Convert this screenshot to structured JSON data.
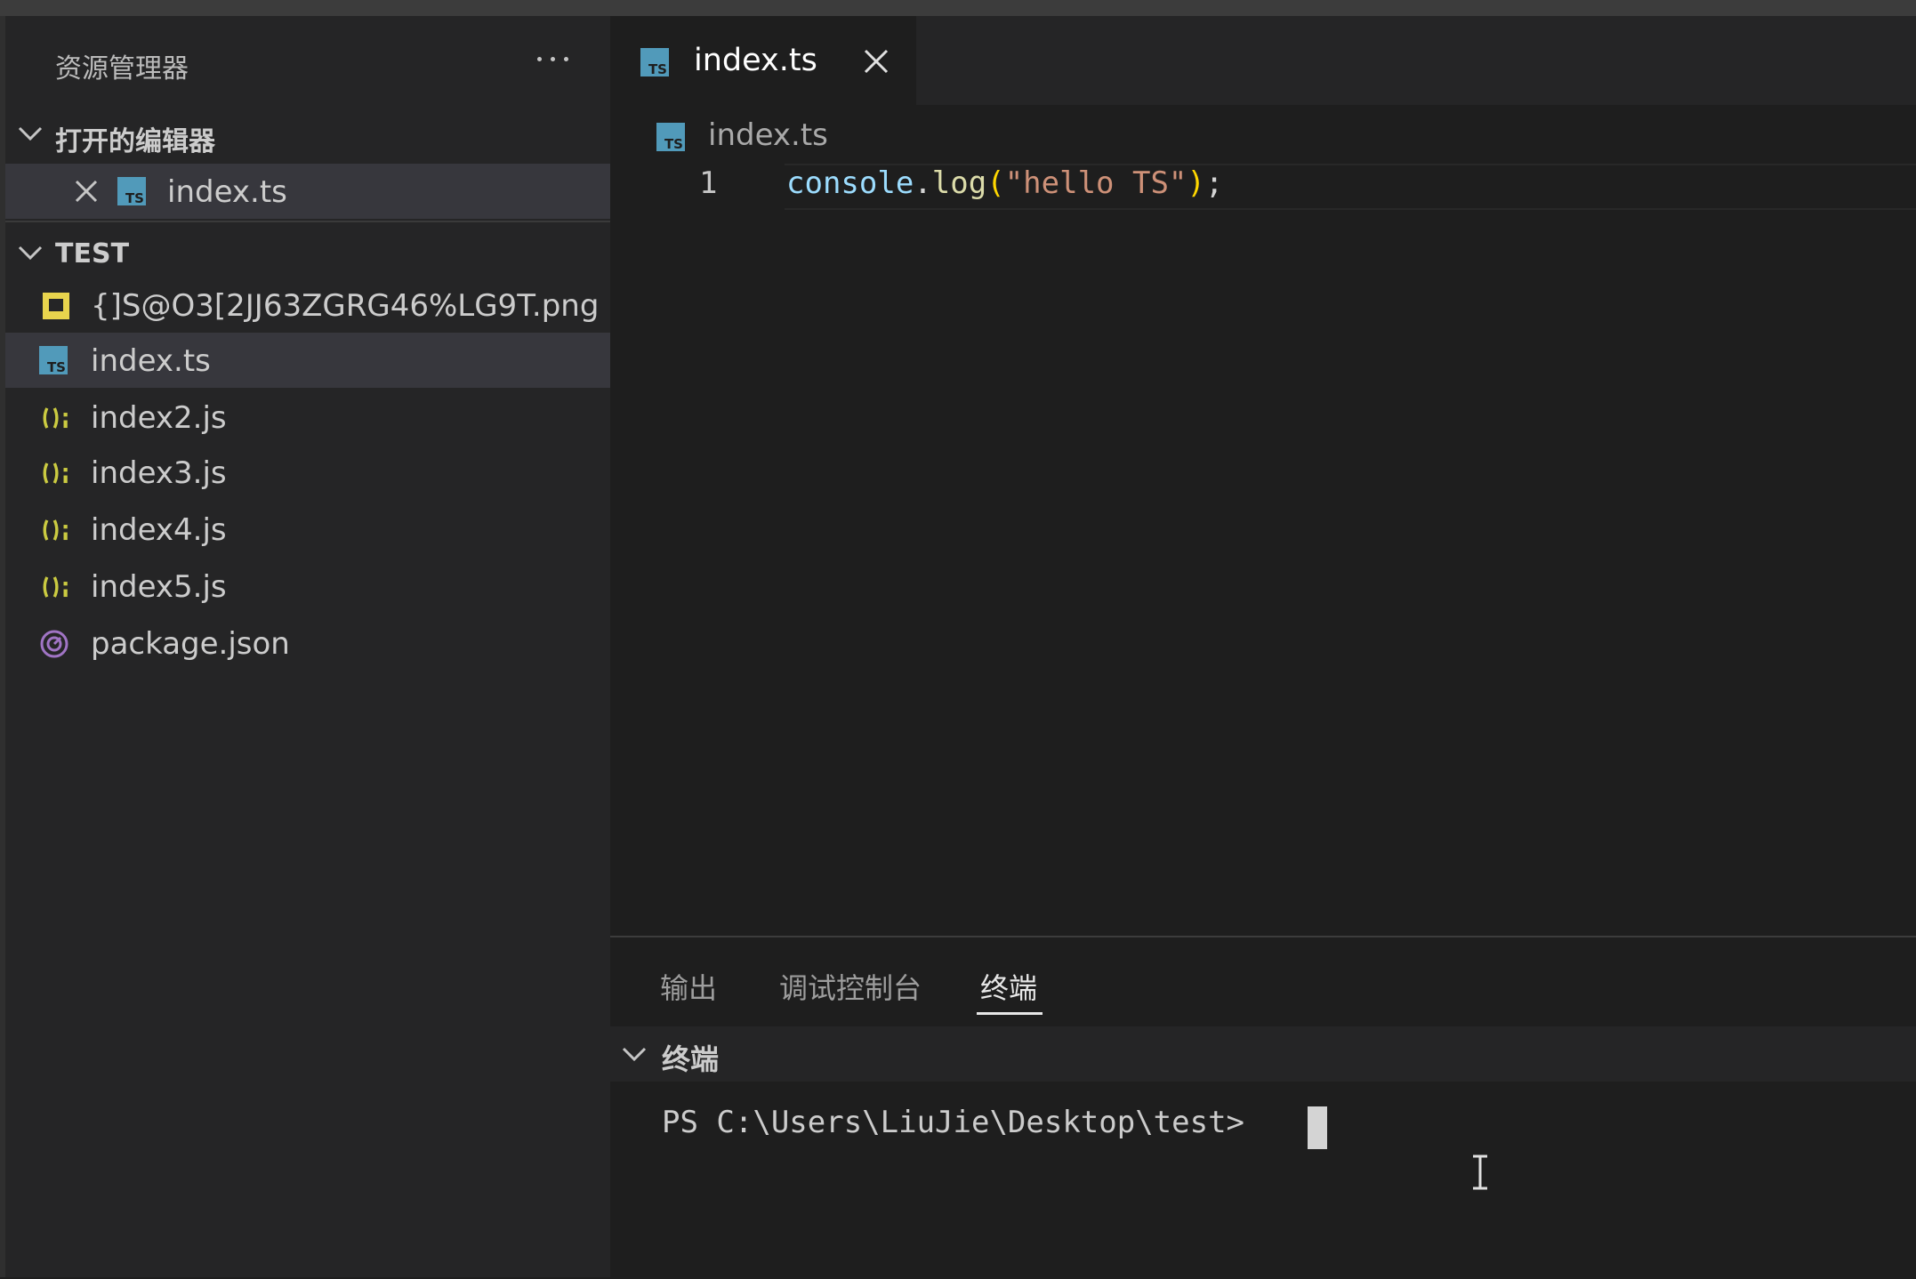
{
  "sidebar": {
    "title": "资源管理器",
    "open_editors": {
      "header": "打开的编辑器",
      "items": [
        {
          "label": "index.ts",
          "icon": "typescript-icon"
        }
      ]
    },
    "folder": {
      "header": "TEST",
      "items": [
        {
          "label": "{]S@O3[2JJ63ZGRG46%LG9T.png",
          "icon": "image-file-icon"
        },
        {
          "label": "index.ts",
          "icon": "typescript-icon",
          "selected": true
        },
        {
          "label": "index2.js",
          "icon": "javascript-icon"
        },
        {
          "label": "index3.js",
          "icon": "javascript-icon"
        },
        {
          "label": "index4.js",
          "icon": "javascript-icon"
        },
        {
          "label": "index5.js",
          "icon": "javascript-icon"
        },
        {
          "label": "package.json",
          "icon": "package-json-icon"
        }
      ]
    }
  },
  "editor": {
    "tab": {
      "label": "index.ts"
    },
    "breadcrumb": "index.ts",
    "line_number": "1",
    "code": {
      "ident": "console",
      "dot": ".",
      "func": "log",
      "open_paren": "(",
      "string": "\"hello TS\"",
      "close_paren": ")",
      "semicolon": ";"
    }
  },
  "panel": {
    "tabs": [
      "输出",
      "调试控制台",
      "终端"
    ],
    "active_tab": "终端",
    "terminal_header": "终端",
    "prompt": "PS C:\\Users\\LiuJie\\Desktop\\test> "
  },
  "colors": {
    "background": "#1e1e1e",
    "sidebar": "#252526",
    "ts_blue": "#519aba",
    "js_yellow": "#cbcb41",
    "png_yellow": "#e8d44d",
    "json_purple": "#a074c4"
  }
}
